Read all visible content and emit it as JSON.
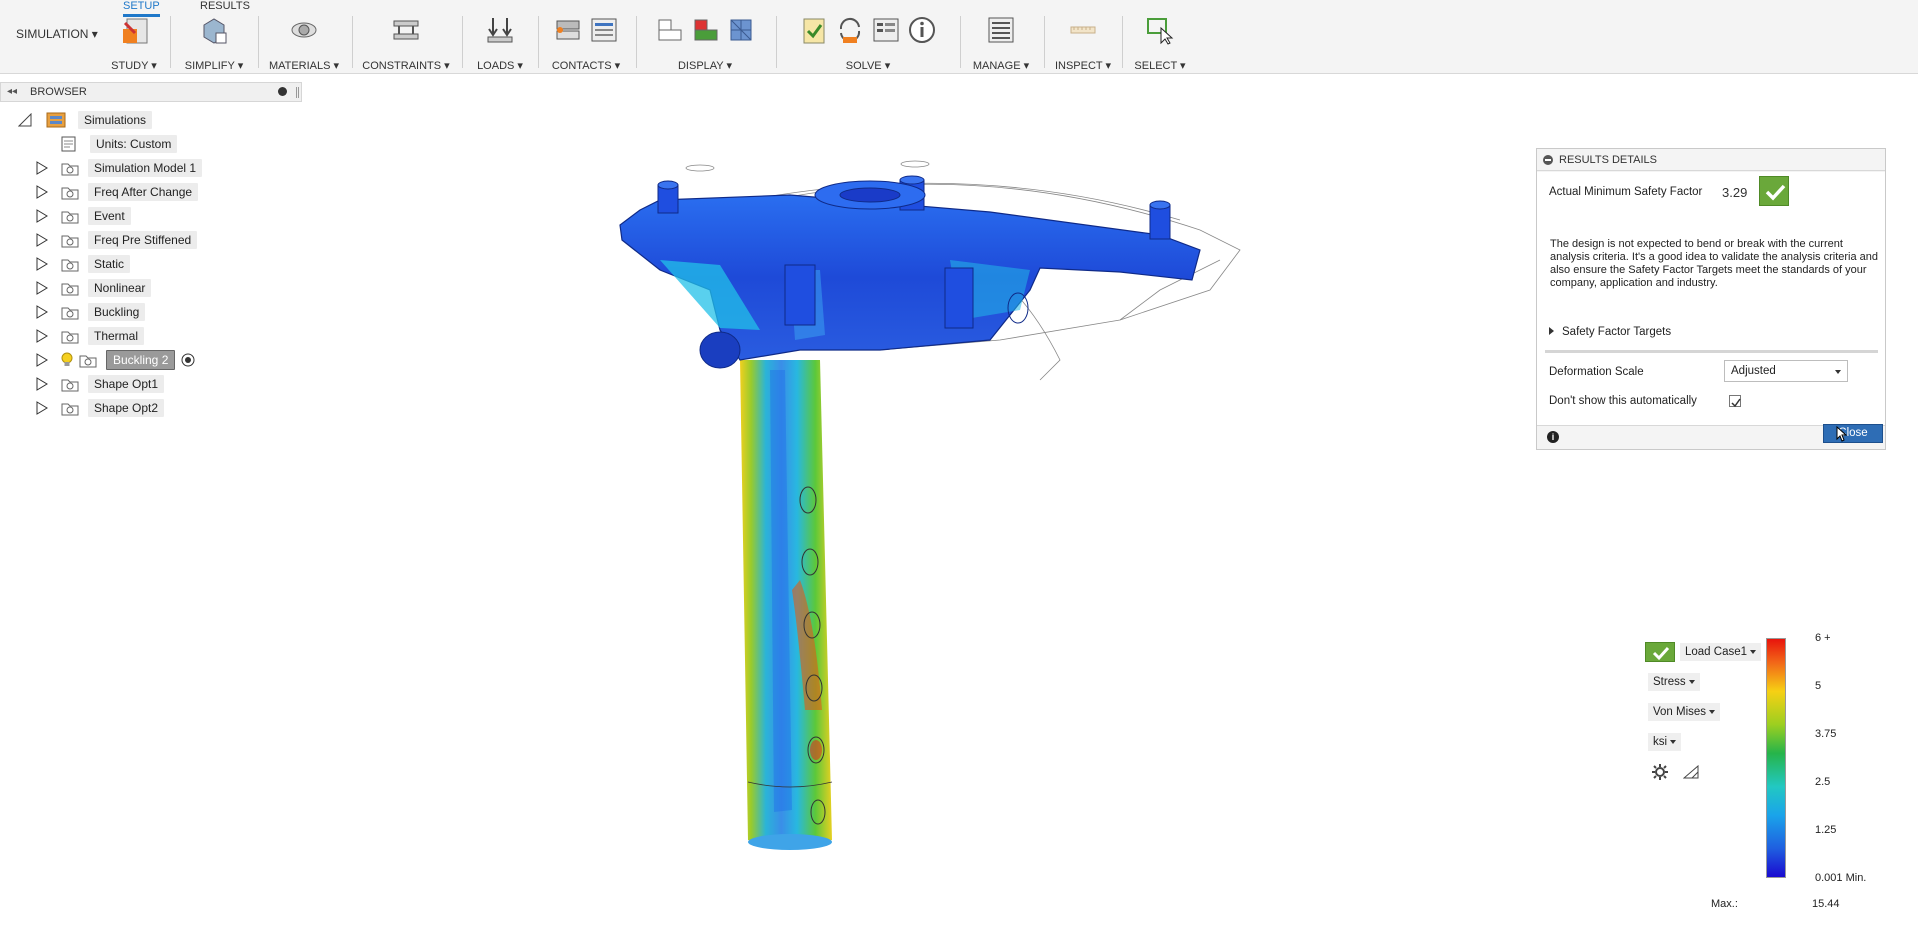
{
  "toolbar": {
    "workspace": "SIMULATION",
    "tabs": [
      {
        "label": "SETUP",
        "active": true
      },
      {
        "label": "RESULTS",
        "active": false
      }
    ],
    "groups": [
      {
        "label": "STUDY"
      },
      {
        "label": "SIMPLIFY"
      },
      {
        "label": "MATERIALS"
      },
      {
        "label": "CONSTRAINTS"
      },
      {
        "label": "LOADS"
      },
      {
        "label": "CONTACTS"
      },
      {
        "label": "DISPLAY"
      },
      {
        "label": "SOLVE"
      },
      {
        "label": "MANAGE"
      },
      {
        "label": "INSPECT"
      },
      {
        "label": "SELECT"
      }
    ]
  },
  "browser": {
    "title": "BROWSER",
    "root": "Simulations",
    "items": [
      {
        "label": "Units: Custom"
      },
      {
        "label": "Simulation Model 1"
      },
      {
        "label": "Freq After Change"
      },
      {
        "label": "Event"
      },
      {
        "label": "Freq Pre Stiffened"
      },
      {
        "label": "Static"
      },
      {
        "label": "Nonlinear"
      },
      {
        "label": "Buckling"
      },
      {
        "label": "Thermal"
      },
      {
        "label": "Buckling 2",
        "selected": true
      },
      {
        "label": "Shape Opt1"
      },
      {
        "label": "Shape Opt2"
      }
    ]
  },
  "results_panel": {
    "title": "RESULTS DETAILS",
    "safety_factor_label": "Actual Minimum Safety Factor",
    "safety_factor_value": "3.29",
    "description": "The design is not expected to bend or break with the current analysis criteria. It's a good idea to validate the analysis criteria and also ensure the Safety Factor Targets meet the standards of your company, application and industry.",
    "safety_factor_targets": "Safety Factor Targets",
    "deformation_label": "Deformation Scale",
    "deformation_value": "Adjusted",
    "dont_show_label": "Don't show this automatically",
    "dont_show_checked": true,
    "close_label": "Close"
  },
  "legend": {
    "load_case": "Load Case1",
    "result_type": "Stress",
    "component": "Von Mises",
    "units": "ksi",
    "ticks": [
      "6 +",
      "5",
      "3.75",
      "2.5",
      "1.25",
      "0.001 Min."
    ],
    "max_label": "Max.:",
    "max_value": "15.44"
  },
  "colors": {
    "accent": "#1f78c9",
    "ok_green": "#6aa83a",
    "close_blue": "#2e6db5"
  }
}
